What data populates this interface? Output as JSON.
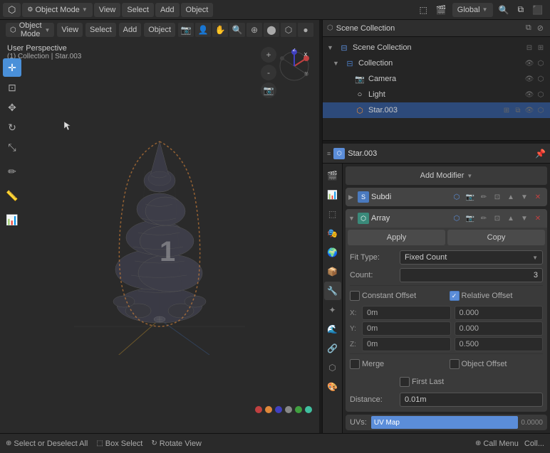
{
  "app": {
    "title": "Blender"
  },
  "top_bar": {
    "object_mode_label": "Object Mode",
    "view_label": "View",
    "select_label": "Select",
    "add_label": "Add",
    "object_label": "Object",
    "global_label": "Global"
  },
  "viewport": {
    "perspective_label": "User Perspective",
    "collection_label": "(1) Collection | Star.003",
    "number": "1"
  },
  "outliner": {
    "title": "Scene Collection",
    "items": [
      {
        "name": "Collection",
        "level": 1,
        "expanded": true,
        "icon": "📦"
      },
      {
        "name": "Camera",
        "level": 2,
        "expanded": false,
        "icon": "📷"
      },
      {
        "name": "Light",
        "level": 2,
        "expanded": false,
        "icon": "💡"
      },
      {
        "name": "Star.003",
        "level": 2,
        "expanded": false,
        "icon": "⭐",
        "selected": true
      }
    ]
  },
  "properties": {
    "object_name": "Star.003",
    "add_modifier_label": "Add Modifier",
    "modifiers": [
      {
        "name": "Subdi",
        "type": "subdivision",
        "icon": "S",
        "expanded": false,
        "header_icons": [
          "realtime",
          "render",
          "edit",
          "cage",
          "pin",
          "up",
          "down",
          "x"
        ]
      },
      {
        "name": "Array",
        "type": "array",
        "icon": "A",
        "expanded": true,
        "apply_label": "Apply",
        "copy_label": "Copy",
        "fit_type_label": "Fit Type:",
        "fit_type_value": "Fixed Count",
        "count_label": "Count:",
        "count_value": "3",
        "constant_offset_label": "Constant Offset",
        "constant_offset_checked": false,
        "relative_offset_label": "Relative Offset",
        "relative_offset_checked": true,
        "x_label": "X:",
        "x_value": "0m",
        "x_right": "0.000",
        "y_label": "Y:",
        "y_value": "0m",
        "y_right": "0.000",
        "z_label": "Z:",
        "z_value": "0m",
        "z_right": "0.500",
        "merge_label": "Merge",
        "merge_checked": false,
        "object_offset_label": "Object Offset",
        "object_offset_checked": false,
        "first_last_label": "First Last",
        "distance_label": "Distance:",
        "distance_value": "0.01m"
      }
    ],
    "uvs_label": "UVs:",
    "uvs_value": "UV Map",
    "uv_value_num": "0.0000"
  },
  "bottom_bar": {
    "select_label": "Select or Deselect All",
    "box_select_label": "Box Select",
    "rotate_view_label": "Rotate View",
    "call_menu_label": "Call Menu",
    "coll_label": "Coll..."
  },
  "side_tabs": [
    {
      "icon": "🔧",
      "name": "tool",
      "active": false
    },
    {
      "icon": "📷",
      "name": "view",
      "active": false
    },
    {
      "icon": "👁",
      "name": "object",
      "active": false
    },
    {
      "icon": "🔲",
      "name": "modifier",
      "active": true
    },
    {
      "icon": "🔵",
      "name": "particles",
      "active": false
    },
    {
      "icon": "🌊",
      "name": "physics",
      "active": false
    },
    {
      "icon": "🔗",
      "name": "constraints",
      "active": false
    },
    {
      "icon": "📊",
      "name": "data",
      "active": false
    },
    {
      "icon": "🎨",
      "name": "material",
      "active": false
    },
    {
      "icon": "🌍",
      "name": "world",
      "active": false
    },
    {
      "icon": "📐",
      "name": "scene",
      "active": false
    }
  ]
}
